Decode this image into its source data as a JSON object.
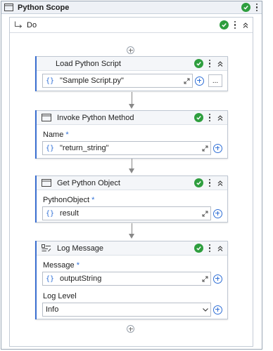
{
  "scope": {
    "title": "Python Scope",
    "icon": "window-icon"
  },
  "sequence": {
    "title": "Do",
    "icon": "return-arrow-icon"
  },
  "activities": [
    {
      "title": "Load Python Script",
      "fields": [
        {
          "value": "\"Sample Script.py\""
        }
      ],
      "more_label": "..."
    },
    {
      "title": "Invoke Python Method",
      "fields": [
        {
          "label": "Name",
          "required": "*",
          "value": "\"return_string\""
        }
      ]
    },
    {
      "title": "Get Python Object",
      "fields": [
        {
          "label": "PythonObject",
          "required": "*",
          "value": "result"
        }
      ]
    },
    {
      "title": "Log Message",
      "fields": [
        {
          "label": "Message",
          "required": "*",
          "value": "outputString"
        }
      ],
      "level": {
        "label": "Log Level",
        "value": "Info"
      }
    }
  ],
  "colors": {
    "accent": "#3b6fd1",
    "success": "#2e9e3e",
    "brace": "#2f6fd6"
  }
}
